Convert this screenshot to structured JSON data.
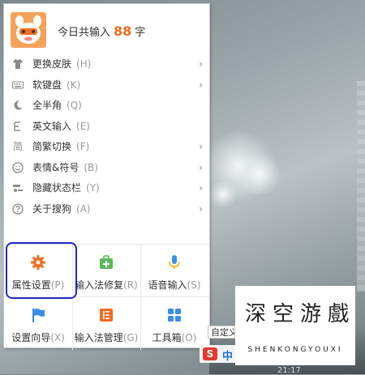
{
  "header": {
    "greeting_prefix": "今日共输入",
    "count": "88",
    "greeting_suffix": "字"
  },
  "menu_items": [
    {
      "label": "更换皮肤",
      "hotkey": "(H)",
      "icon": "tshirt-icon",
      "has_submenu": true
    },
    {
      "label": "软键盘",
      "hotkey": "(K)",
      "icon": "keyboard-icon",
      "has_submenu": true
    },
    {
      "label": "全半角",
      "hotkey": "(Q)",
      "icon": "moon-icon",
      "has_submenu": false
    },
    {
      "label": "英文输入",
      "hotkey": "(E)",
      "icon": "letter-e-icon",
      "has_submenu": false
    },
    {
      "label": "简繁切换",
      "hotkey": "(F)",
      "icon": "jian-char-icon",
      "has_submenu": true
    },
    {
      "label": "表情&符号",
      "hotkey": "(B)",
      "icon": "smiley-icon",
      "has_submenu": true
    },
    {
      "label": "隐藏状态栏",
      "hotkey": "(Y)",
      "icon": "statusbar-icon",
      "has_submenu": true
    },
    {
      "label": "关于搜狗",
      "hotkey": "(A)",
      "icon": "question-icon",
      "has_submenu": true
    }
  ],
  "grid": [
    {
      "label": "属性设置",
      "hotkey": "(P)",
      "icon": "gear-icon",
      "color": "#f26b1d"
    },
    {
      "label": "输入法修复",
      "hotkey": "(R)",
      "icon": "repair-kit-icon",
      "color": "#5cb85c"
    },
    {
      "label": "语音输入",
      "hotkey": "(S)",
      "icon": "microphone-icon",
      "color": "#3a8ee6"
    },
    {
      "label": "设置向导",
      "hotkey": "(X)",
      "icon": "flag-icon",
      "color": "#3a8ee6"
    },
    {
      "label": "输入法管理",
      "hotkey": "(G)",
      "icon": "manage-icon",
      "color": "#f26b1d"
    },
    {
      "label": "工具箱",
      "hotkey": "(O)",
      "icon": "toolbox-icon",
      "color": "#3a8ee6"
    }
  ],
  "watermark": {
    "chars": [
      "深",
      "空",
      "游",
      "戲"
    ],
    "subtitle": "SHENKONGYOUXI"
  },
  "taskbar": {
    "tooltip": "自定义",
    "ime_label": "中",
    "clock": "21:17"
  },
  "colors": {
    "accent": "#f26b1d",
    "highlight": "#1f2bc6"
  }
}
